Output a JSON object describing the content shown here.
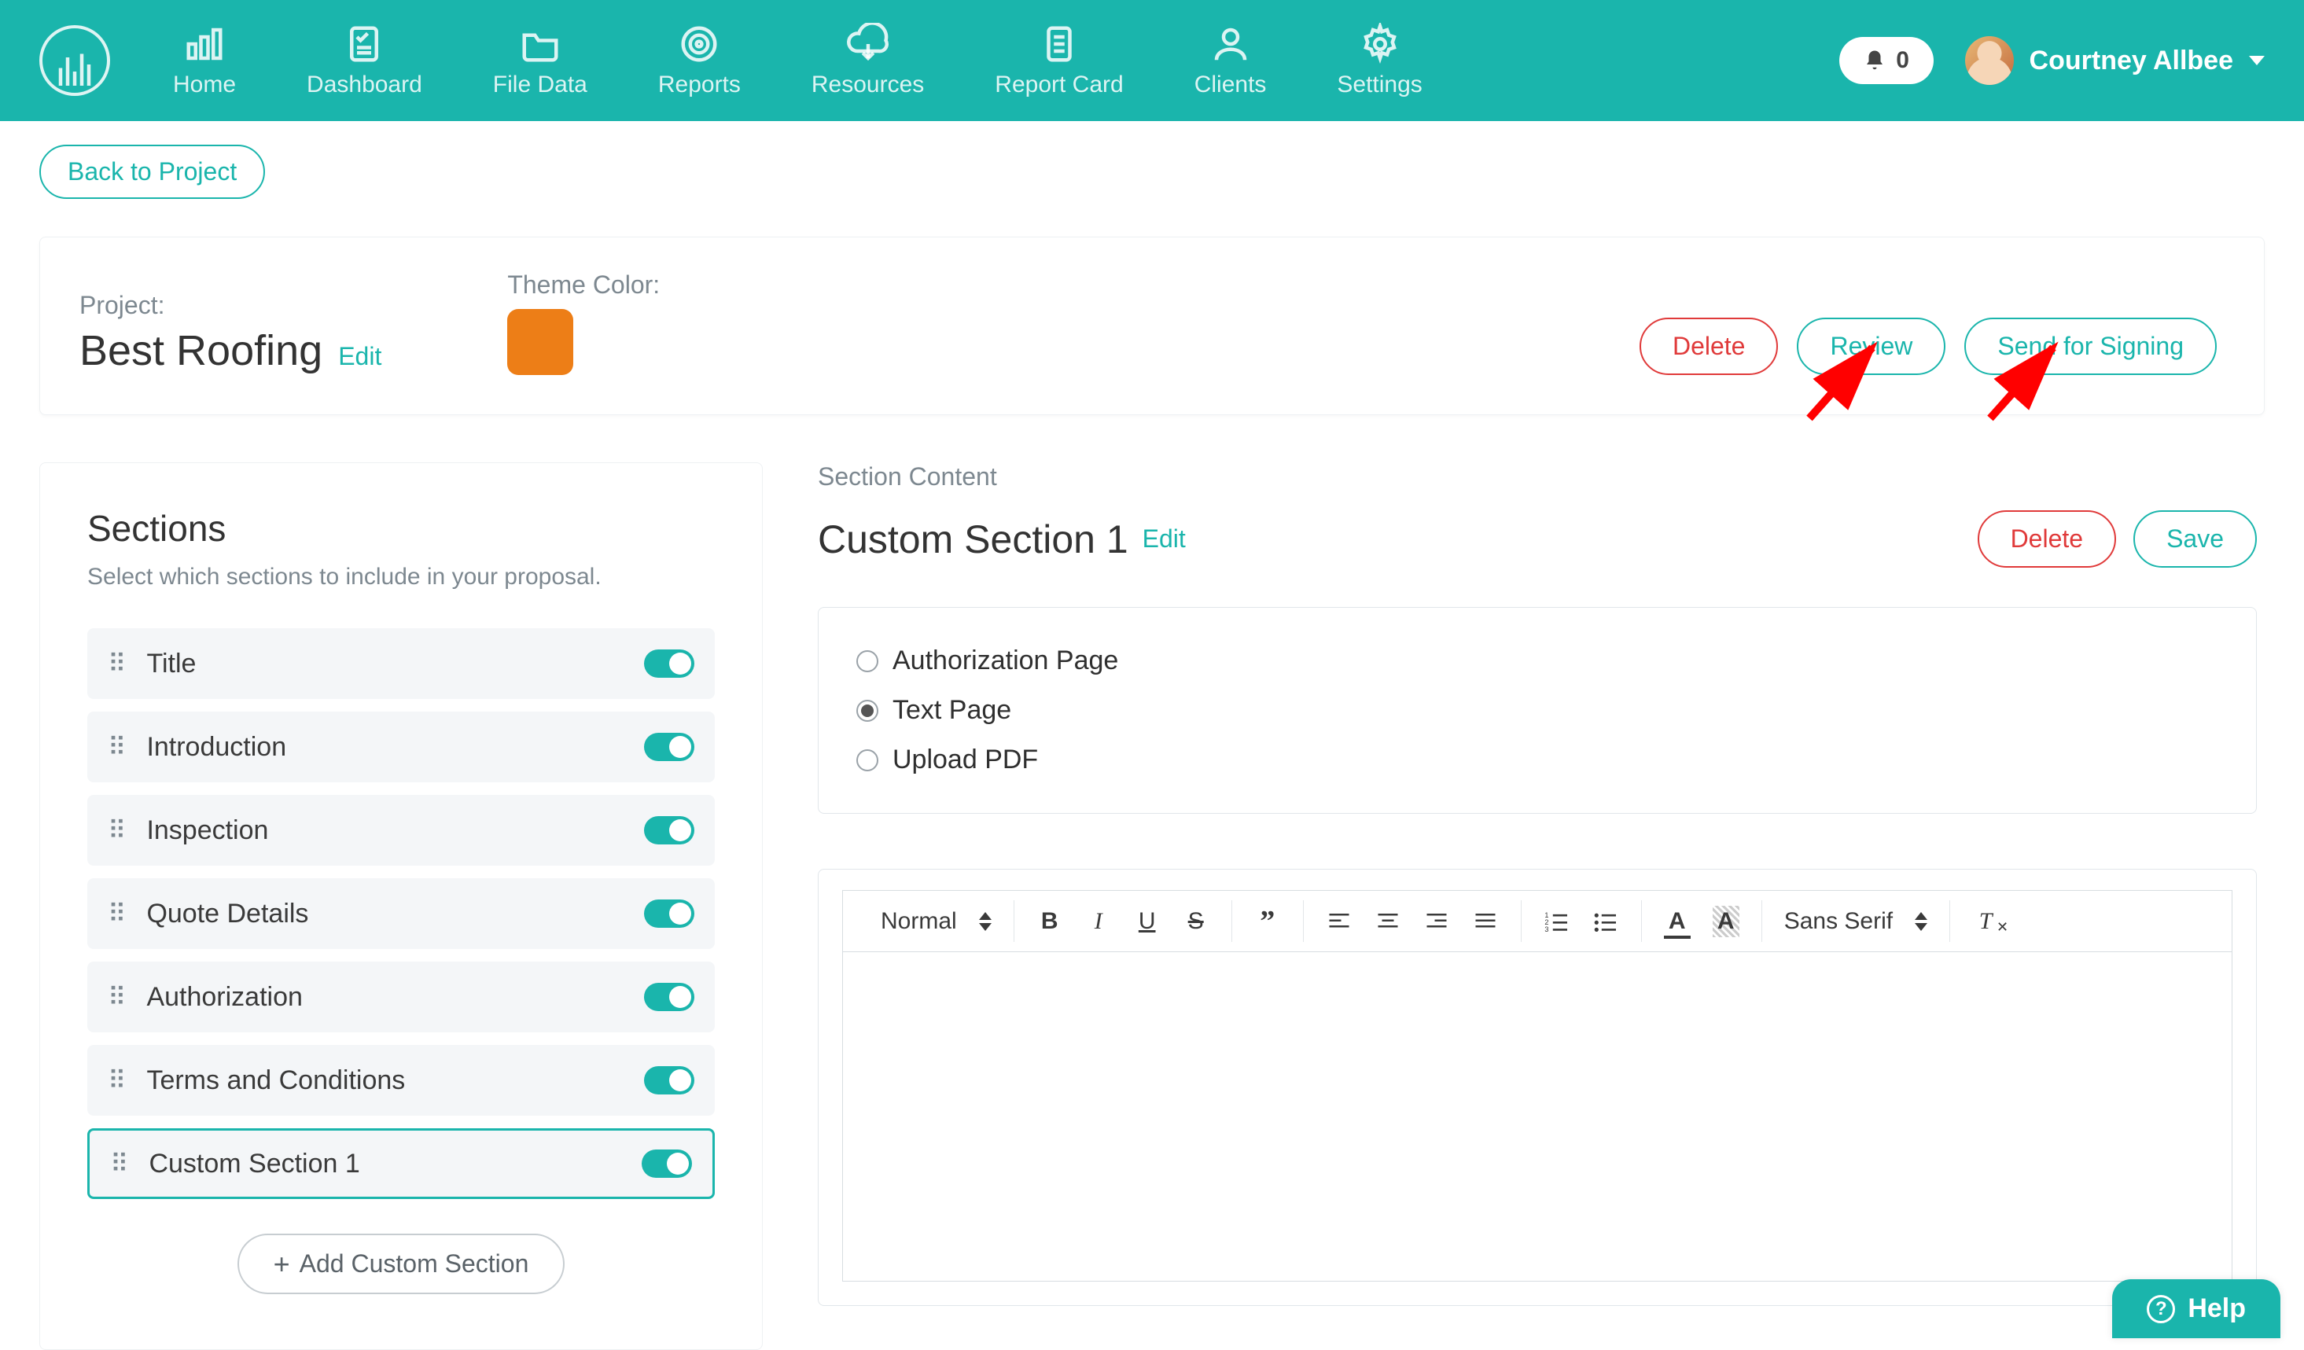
{
  "nav": {
    "items": [
      {
        "label": "Home"
      },
      {
        "label": "Dashboard"
      },
      {
        "label": "File Data"
      },
      {
        "label": "Reports"
      },
      {
        "label": "Resources"
      },
      {
        "label": "Report Card"
      },
      {
        "label": "Clients"
      },
      {
        "label": "Settings"
      }
    ],
    "notification_count": "0",
    "user_name": "Courtney Allbee"
  },
  "back_button": "Back to Project",
  "project": {
    "label": "Project:",
    "name": "Best Roofing",
    "edit": "Edit",
    "theme_label": "Theme Color:",
    "theme_color": "#ed7e17",
    "actions": {
      "delete": "Delete",
      "review": "Review",
      "send": "Send for Signing"
    }
  },
  "sections_panel": {
    "title": "Sections",
    "subtitle": "Select which sections to include in your proposal.",
    "items": [
      {
        "label": "Title",
        "on": true,
        "active": false
      },
      {
        "label": "Introduction",
        "on": true,
        "active": false
      },
      {
        "label": "Inspection",
        "on": true,
        "active": false
      },
      {
        "label": "Quote Details",
        "on": true,
        "active": false
      },
      {
        "label": "Authorization",
        "on": true,
        "active": false
      },
      {
        "label": "Terms and Conditions",
        "on": true,
        "active": false
      },
      {
        "label": "Custom Section 1",
        "on": true,
        "active": true
      }
    ],
    "add_label": "Add Custom Section"
  },
  "content": {
    "section_content_label": "Section Content",
    "title": "Custom Section 1",
    "edit": "Edit",
    "actions": {
      "delete": "Delete",
      "save": "Save"
    },
    "page_types": [
      {
        "label": "Authorization Page",
        "checked": false
      },
      {
        "label": "Text Page",
        "checked": true
      },
      {
        "label": "Upload PDF",
        "checked": false
      }
    ],
    "toolbar": {
      "style_select": "Normal",
      "font_select": "Sans Serif"
    }
  },
  "help_label": "Help"
}
